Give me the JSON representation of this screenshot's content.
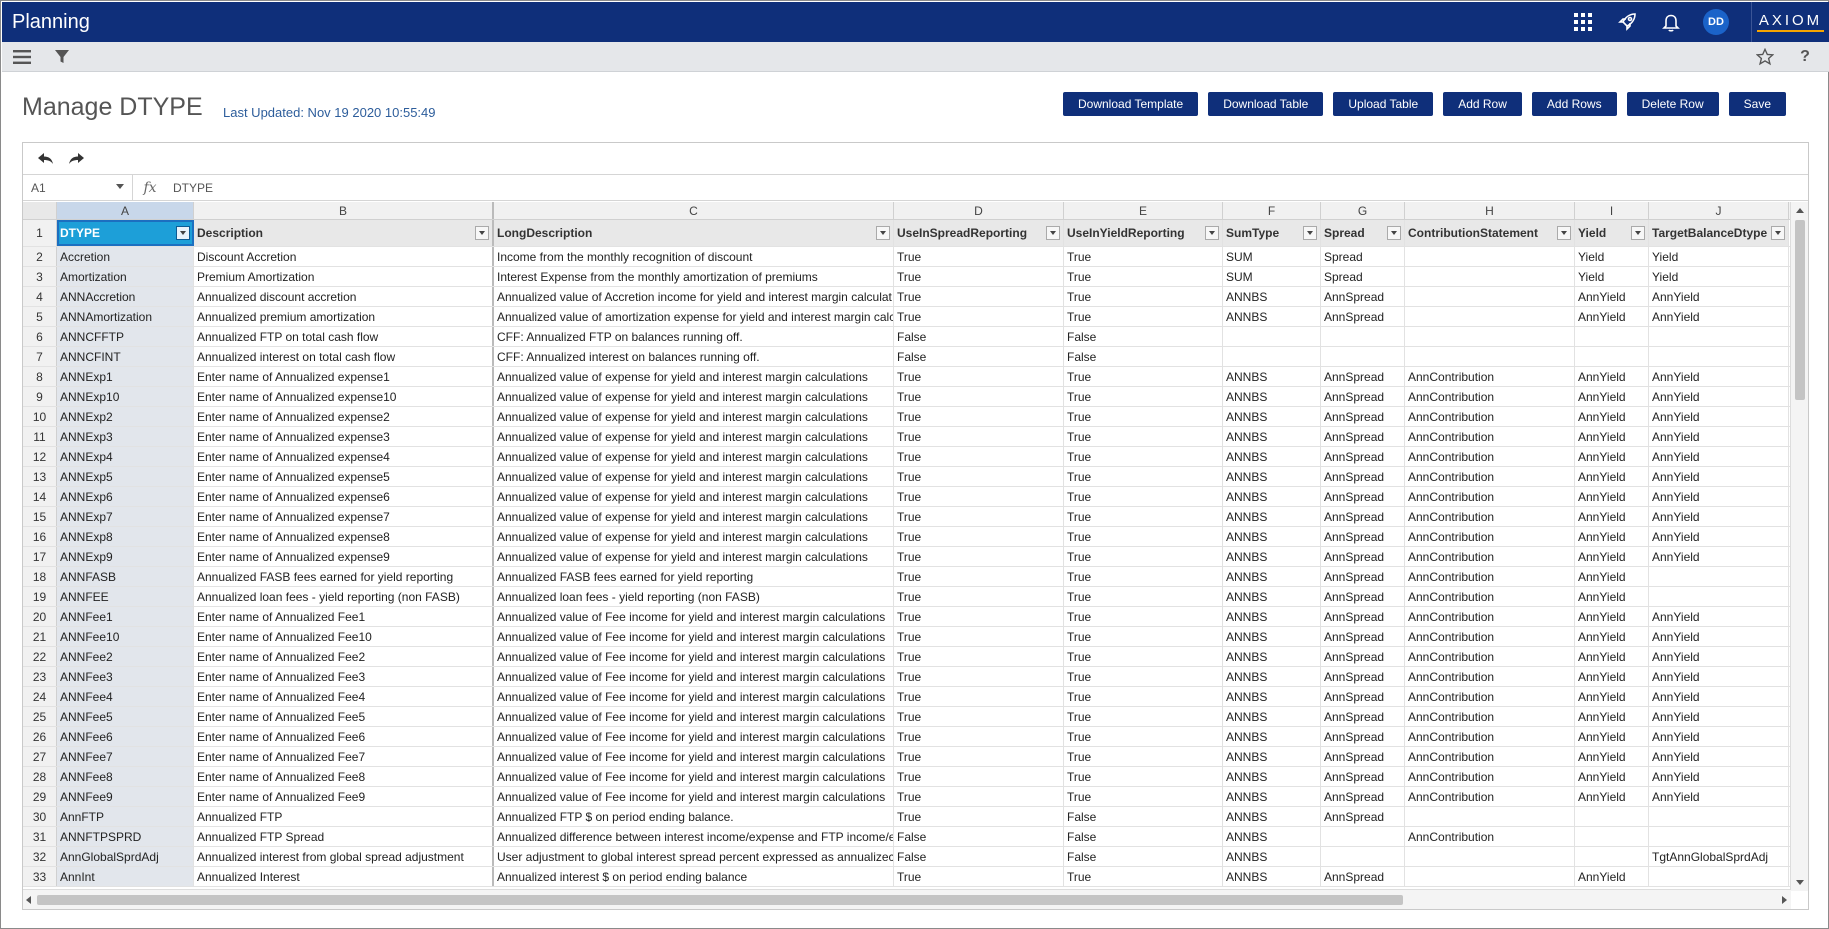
{
  "app": {
    "title": "Planning",
    "brand": "AXIOM",
    "user_initials": "DD"
  },
  "icons": {
    "apps": "grid-apps-icon",
    "launch": "rocket-icon",
    "notifications": "bell-icon",
    "menu": "hamburger-menu-icon",
    "filter": "funnel-filter-icon",
    "favorite": "star-icon",
    "help": "question-icon"
  },
  "page": {
    "title": "Manage DTYPE",
    "last_updated": "Last Updated: Nov 19 2020 10:55:49"
  },
  "toolbar": {
    "download_template": "Download Template",
    "download_table": "Download Table",
    "upload_table": "Upload Table",
    "add_row": "Add Row",
    "add_rows": "Add Rows",
    "delete_row": "Delete Row",
    "save": "Save"
  },
  "formula": {
    "cell_ref": "A1",
    "fx": "fx",
    "value": "DTYPE"
  },
  "columns": [
    "A",
    "B",
    "C",
    "D",
    "E",
    "F",
    "G",
    "H",
    "I",
    "J"
  ],
  "headers": [
    "DTYPE",
    "Description",
    "LongDescription",
    "UseInSpreadReporting",
    "UseInYieldReporting",
    "SumType",
    "Spread",
    "ContributionStatement",
    "Yield",
    "TargetBalanceDtype"
  ],
  "rows": [
    [
      "2",
      "Accretion",
      "Discount Accretion",
      "Income from the monthly recognition of discount",
      "True",
      "True",
      "SUM",
      "Spread",
      "",
      "Yield",
      "Yield"
    ],
    [
      "3",
      "Amortization",
      "Premium Amortization",
      "Interest Expense from the monthly amortization of premiums",
      "True",
      "True",
      "SUM",
      "Spread",
      "",
      "Yield",
      "Yield"
    ],
    [
      "4",
      "ANNAccretion",
      "Annualized discount accretion",
      "Annualized value of Accretion income for yield and interest margin calculat",
      "True",
      "True",
      "ANNBS",
      "AnnSpread",
      "",
      "AnnYield",
      "AnnYield"
    ],
    [
      "5",
      "ANNAmortization",
      "Annualized premium amortization",
      "Annualized value of amortization expense for yield and interest margin calc",
      "True",
      "True",
      "ANNBS",
      "AnnSpread",
      "",
      "AnnYield",
      "AnnYield"
    ],
    [
      "6",
      "ANNCFFTP",
      "Annualized FTP on total cash flow",
      "CFF:  Annualized FTP on balances running off.",
      "False",
      "False",
      "",
      "",
      "",
      "",
      ""
    ],
    [
      "7",
      "ANNCFINT",
      "Annualized interest on total cash flow",
      "CFF:  Annualized interest on balances running off.",
      "False",
      "False",
      "",
      "",
      "",
      "",
      ""
    ],
    [
      "8",
      "ANNExp1",
      "Enter name of Annualized expense1",
      "Annualized value of expense for yield and interest margin calculations",
      "True",
      "True",
      "ANNBS",
      "AnnSpread",
      "AnnContribution",
      "AnnYield",
      "AnnYield"
    ],
    [
      "9",
      "ANNExp10",
      "Enter name of Annualized expense10",
      "Annualized value of expense for yield and interest margin calculations",
      "True",
      "True",
      "ANNBS",
      "AnnSpread",
      "AnnContribution",
      "AnnYield",
      "AnnYield"
    ],
    [
      "10",
      "ANNExp2",
      "Enter name of Annualized expense2",
      "Annualized value of expense for yield and interest margin calculations",
      "True",
      "True",
      "ANNBS",
      "AnnSpread",
      "AnnContribution",
      "AnnYield",
      "AnnYield"
    ],
    [
      "11",
      "ANNExp3",
      "Enter name of Annualized expense3",
      "Annualized value of expense for yield and interest margin calculations",
      "True",
      "True",
      "ANNBS",
      "AnnSpread",
      "AnnContribution",
      "AnnYield",
      "AnnYield"
    ],
    [
      "12",
      "ANNExp4",
      "Enter name of Annualized expense4",
      "Annualized value of expense for yield and interest margin calculations",
      "True",
      "True",
      "ANNBS",
      "AnnSpread",
      "AnnContribution",
      "AnnYield",
      "AnnYield"
    ],
    [
      "13",
      "ANNExp5",
      "Enter name of Annualized expense5",
      "Annualized value of expense for yield and interest margin calculations",
      "True",
      "True",
      "ANNBS",
      "AnnSpread",
      "AnnContribution",
      "AnnYield",
      "AnnYield"
    ],
    [
      "14",
      "ANNExp6",
      "Enter name of Annualized expense6",
      "Annualized value of expense for yield and interest margin calculations",
      "True",
      "True",
      "ANNBS",
      "AnnSpread",
      "AnnContribution",
      "AnnYield",
      "AnnYield"
    ],
    [
      "15",
      "ANNExp7",
      "Enter name of Annualized expense7",
      "Annualized value of expense for yield and interest margin calculations",
      "True",
      "True",
      "ANNBS",
      "AnnSpread",
      "AnnContribution",
      "AnnYield",
      "AnnYield"
    ],
    [
      "16",
      "ANNExp8",
      "Enter name of Annualized expense8",
      "Annualized value of expense for yield and interest margin calculations",
      "True",
      "True",
      "ANNBS",
      "AnnSpread",
      "AnnContribution",
      "AnnYield",
      "AnnYield"
    ],
    [
      "17",
      "ANNExp9",
      "Enter name of Annualized expense9",
      "Annualized value of expense for yield and interest margin calculations",
      "True",
      "True",
      "ANNBS",
      "AnnSpread",
      "AnnContribution",
      "AnnYield",
      "AnnYield"
    ],
    [
      "18",
      "ANNFASB",
      "Annualized FASB fees earned for yield reporting",
      "Annualized FASB fees earned for yield reporting",
      "True",
      "True",
      "ANNBS",
      "AnnSpread",
      "AnnContribution",
      "AnnYield",
      ""
    ],
    [
      "19",
      "ANNFEE",
      "Annualized loan fees - yield reporting (non FASB)",
      "Annualized loan fees - yield reporting (non FASB)",
      "True",
      "True",
      "ANNBS",
      "AnnSpread",
      "AnnContribution",
      "AnnYield",
      ""
    ],
    [
      "20",
      "ANNFee1",
      "Enter name of Annualized Fee1",
      "Annualized value of Fee income for yield and interest margin calculations",
      "True",
      "True",
      "ANNBS",
      "AnnSpread",
      "AnnContribution",
      "AnnYield",
      "AnnYield"
    ],
    [
      "21",
      "ANNFee10",
      "Enter name of Annualized Fee10",
      "Annualized value of Fee income for yield and interest margin calculations",
      "True",
      "True",
      "ANNBS",
      "AnnSpread",
      "AnnContribution",
      "AnnYield",
      "AnnYield"
    ],
    [
      "22",
      "ANNFee2",
      "Enter name of Annualized Fee2",
      "Annualized value of Fee income for yield and interest margin calculations",
      "True",
      "True",
      "ANNBS",
      "AnnSpread",
      "AnnContribution",
      "AnnYield",
      "AnnYield"
    ],
    [
      "23",
      "ANNFee3",
      "Enter name of Annualized Fee3",
      "Annualized value of Fee income for yield and interest margin calculations",
      "True",
      "True",
      "ANNBS",
      "AnnSpread",
      "AnnContribution",
      "AnnYield",
      "AnnYield"
    ],
    [
      "24",
      "ANNFee4",
      "Enter name of Annualized Fee4",
      "Annualized value of Fee income for yield and interest margin calculations",
      "True",
      "True",
      "ANNBS",
      "AnnSpread",
      "AnnContribution",
      "AnnYield",
      "AnnYield"
    ],
    [
      "25",
      "ANNFee5",
      "Enter name of Annualized Fee5",
      "Annualized value of Fee income for yield and interest margin calculations",
      "True",
      "True",
      "ANNBS",
      "AnnSpread",
      "AnnContribution",
      "AnnYield",
      "AnnYield"
    ],
    [
      "26",
      "ANNFee6",
      "Enter name of Annualized Fee6",
      "Annualized value of Fee income for yield and interest margin calculations",
      "True",
      "True",
      "ANNBS",
      "AnnSpread",
      "AnnContribution",
      "AnnYield",
      "AnnYield"
    ],
    [
      "27",
      "ANNFee7",
      "Enter name of Annualized Fee7",
      "Annualized value of Fee income for yield and interest margin calculations",
      "True",
      "True",
      "ANNBS",
      "AnnSpread",
      "AnnContribution",
      "AnnYield",
      "AnnYield"
    ],
    [
      "28",
      "ANNFee8",
      "Enter name of Annualized Fee8",
      "Annualized value of Fee income for yield and interest margin calculations",
      "True",
      "True",
      "ANNBS",
      "AnnSpread",
      "AnnContribution",
      "AnnYield",
      "AnnYield"
    ],
    [
      "29",
      "ANNFee9",
      "Enter name of Annualized Fee9",
      "Annualized value of Fee income for yield and interest margin calculations",
      "True",
      "True",
      "ANNBS",
      "AnnSpread",
      "AnnContribution",
      "AnnYield",
      "AnnYield"
    ],
    [
      "30",
      "AnnFTP",
      "Annualized FTP",
      "Annualized FTP $ on period ending balance.",
      "True",
      "False",
      "ANNBS",
      "AnnSpread",
      "",
      "",
      ""
    ],
    [
      "31",
      "ANNFTPSPRD",
      "Annualized FTP Spread",
      "Annualized difference between interest income/expense and FTP income/e",
      "False",
      "False",
      "ANNBS",
      "",
      "AnnContribution",
      "",
      ""
    ],
    [
      "32",
      "AnnGlobalSprdAdj",
      "Annualized interest from global spread adjustment",
      "User adjustment to global interest spread percent expressed as annualizec",
      "False",
      "False",
      "ANNBS",
      "",
      "",
      "",
      "TgtAnnGlobalSprdAdj"
    ],
    [
      "33",
      "AnnInt",
      "Annualized Interest",
      "Annualized interest $ on period ending balance",
      "True",
      "True",
      "ANNBS",
      "AnnSpread",
      "",
      "AnnYield",
      ""
    ]
  ]
}
